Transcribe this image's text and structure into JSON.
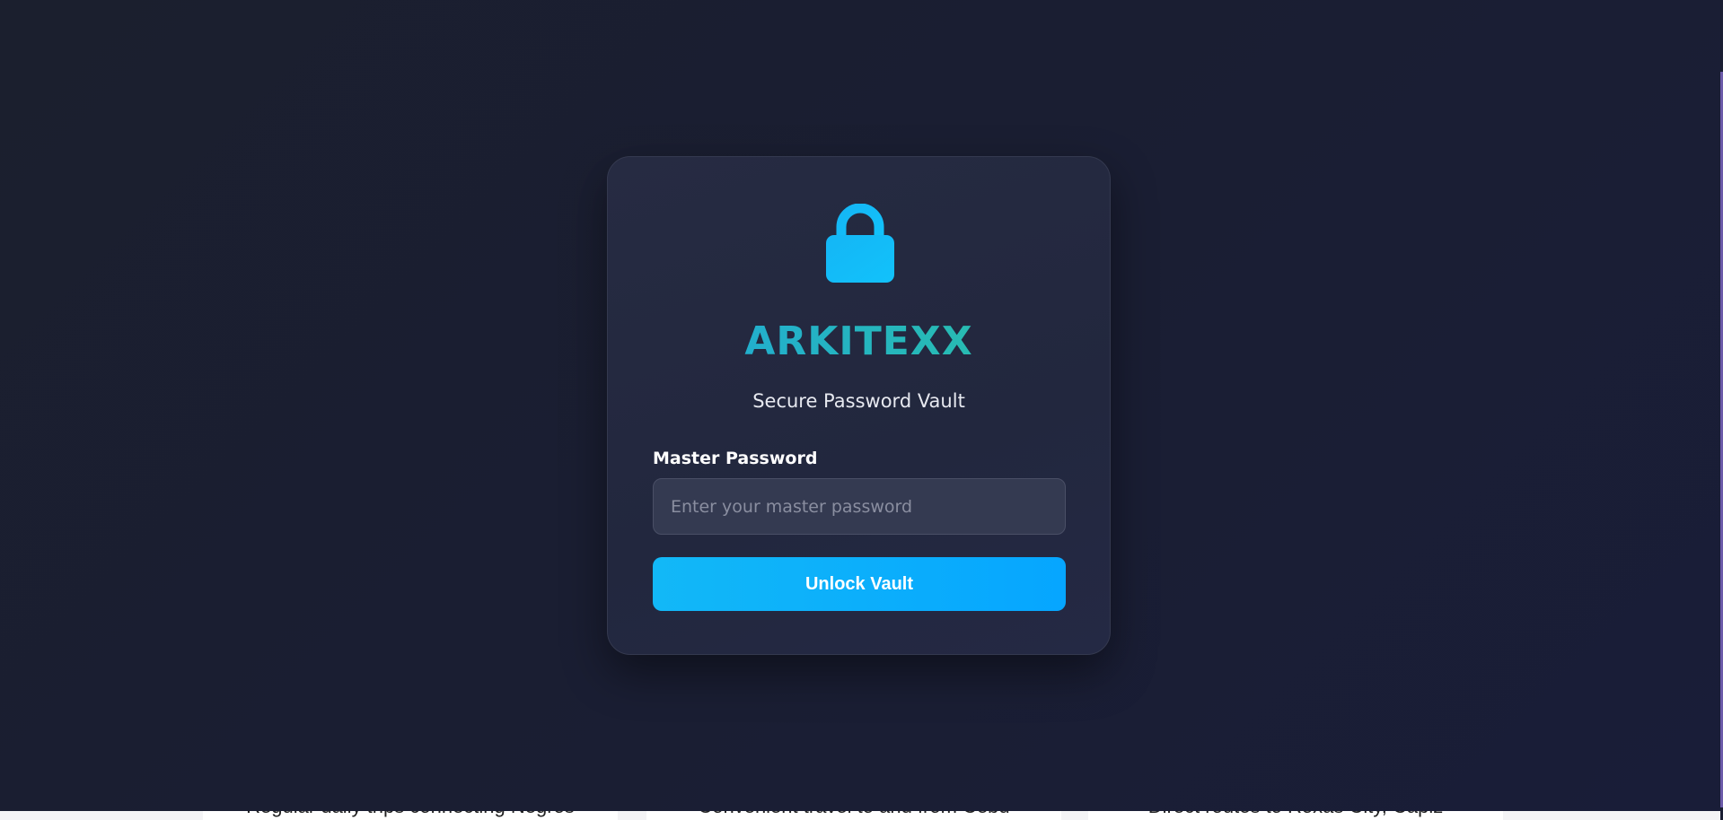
{
  "login": {
    "brand": "ARKITEXX",
    "subtitle": "Secure Password Vault",
    "password_label": "Master Password",
    "password_value": "",
    "password_placeholder": "Enter your master password",
    "unlock_label": "Unlock Vault",
    "icon": "lock-icon"
  },
  "background_page": {
    "cards": [
      {
        "text": "Regular daily trips connecting Negros"
      },
      {
        "text": "Convenient travel to and from Cebu"
      },
      {
        "text": "Direct routes to Roxas City, Capiz"
      }
    ]
  },
  "colors": {
    "overlay_background": "#1a1e33",
    "card_background": "#242940",
    "accent": "#0ea5f5",
    "brand_gradient_start": "#1fa7dd",
    "brand_gradient_end": "#2bc3a2",
    "lock_icon": "#14b6f5"
  }
}
